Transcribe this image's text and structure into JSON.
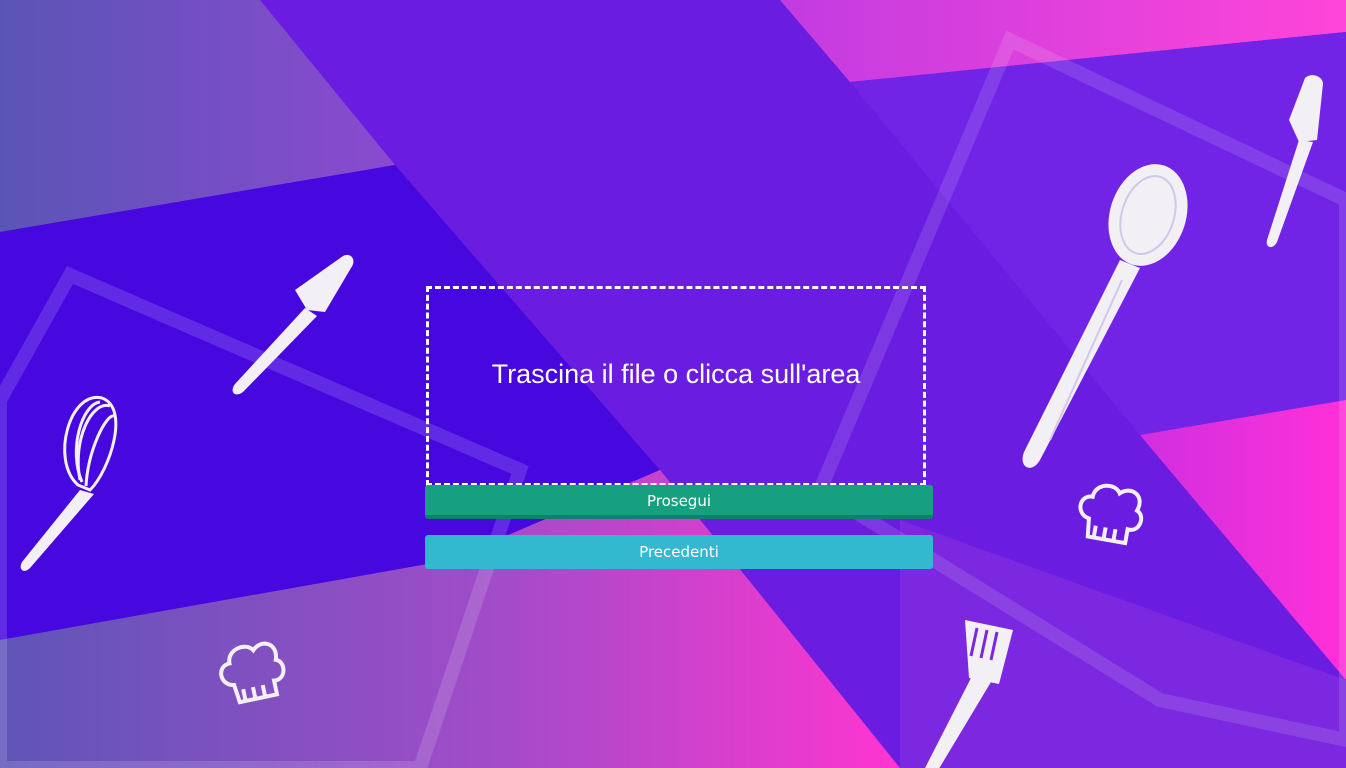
{
  "upload": {
    "dropzone_label": "Trascina il file o clicca sull'area"
  },
  "actions": {
    "next_label": "Prosegui",
    "previous_label": "Precedenti"
  },
  "colors": {
    "background_primary": "#5a12e0",
    "background_accent": "#ff2fd6",
    "next_button": "#17a07f",
    "previous_button": "#33b9cf",
    "dropzone_border": "#ffffff"
  },
  "decorations": [
    "whisk-icon",
    "spatula-icon",
    "spoon-icon",
    "fork-icon",
    "chef-hat-icon"
  ]
}
